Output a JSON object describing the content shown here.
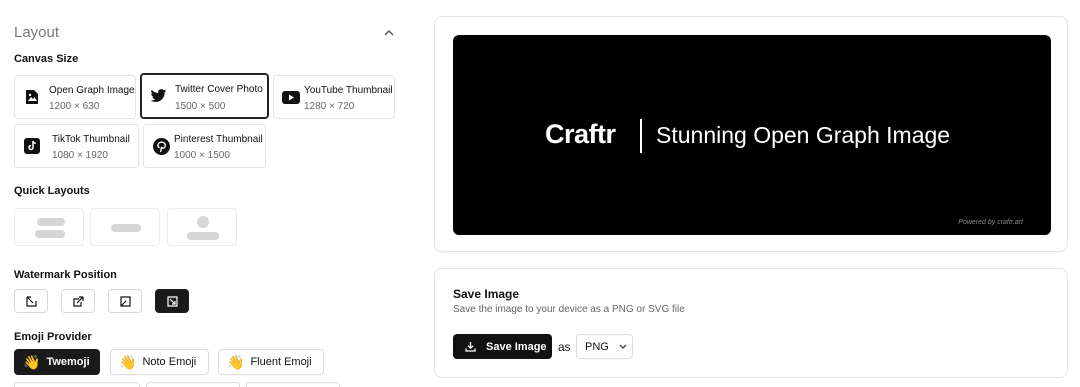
{
  "layout": {
    "title": "Layout",
    "canvas_size": {
      "label": "Canvas Size",
      "options": [
        {
          "name": "Open Graph Image",
          "size": "1200 × 630",
          "icon": "image-icon"
        },
        {
          "name": "Twitter Cover Photo",
          "size": "1500 × 500",
          "icon": "twitter-icon"
        },
        {
          "name": "YouTube Thumbnail",
          "size": "1280 × 720",
          "icon": "youtube-icon"
        },
        {
          "name": "TikTok Thumbnail",
          "size": "1080 × 1920",
          "icon": "tiktok-icon"
        },
        {
          "name": "Pinterest Thumbnail",
          "size": "1000 × 1500",
          "icon": "pinterest-icon"
        }
      ],
      "selected": "Twitter Cover Photo"
    },
    "quick_layouts": {
      "label": "Quick Layouts"
    },
    "watermark": {
      "label": "Watermark Position",
      "selected": "bottom-right"
    },
    "emoji": {
      "label": "Emoji Provider",
      "options": [
        {
          "name": "Twemoji",
          "emoji": "👋"
        },
        {
          "name": "Noto Emoji",
          "emoji": "👋"
        },
        {
          "name": "Fluent Emoji",
          "emoji": "👋"
        }
      ],
      "selected": "Twemoji"
    }
  },
  "preview": {
    "brand": "Craftr",
    "tagline": "Stunning Open Graph Image",
    "powered_by": "Powered by craftr.art"
  },
  "save": {
    "title": "Save Image",
    "description": "Save the image to your device as a PNG or SVG file",
    "button_label": "Save Image",
    "as_label": "as",
    "format": "PNG"
  },
  "colors": {
    "accent": "#111111",
    "border": "#e4e4e4",
    "canvas_bg": "#000000"
  }
}
